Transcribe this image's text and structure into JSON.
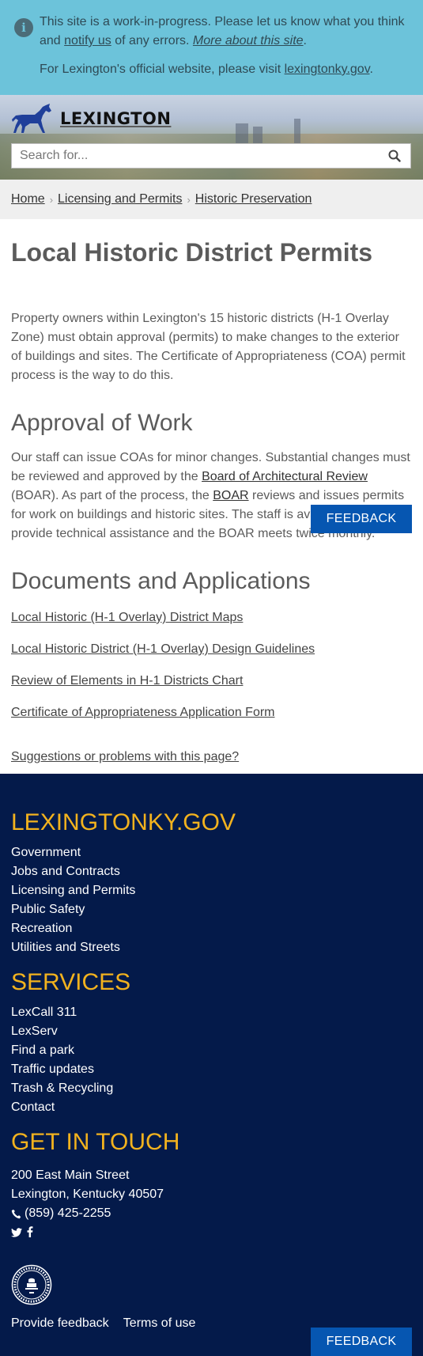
{
  "banner": {
    "icon": "info-icon",
    "msg_prefix": "This site is a work-in-progress. Please let us know what you think and",
    "notify_link": "notify us",
    "msg_middle": "of any errors.",
    "more_link": "More about this site",
    "msg_end": ".",
    "official_prefix": "For Lexington's official website, please visit",
    "official_link": "lexingtonky.gov",
    "official_end": "."
  },
  "header": {
    "logo_icon": "horse-icon",
    "brand": "LEXINGTON",
    "search_placeholder": "Search for...",
    "search_icon": "search-icon"
  },
  "breadcrumb": {
    "items": [
      "Home",
      "Licensing and Permits",
      "Historic Preservation"
    ]
  },
  "main": {
    "title": "Local Historic District Permits",
    "intro": "Property owners within Lexington's 15 historic districts (H-1 Overlay Zone) must obtain approval (permits) to make changes to the exterior of buildings and sites. The Certificate of Appropriateness (COA) permit process is the way to do this.",
    "approval_heading": "Approval of Work",
    "approval_part1": "Our staff can issue COAs for minor changes. Substantial changes must be reviewed and approved by the",
    "boar_link": "Board of Architectural Review",
    "approval_part2": "(BOAR). As part of the process, the",
    "boar_short_link": "BOAR",
    "approval_part3": "reviews and issues permits for work on buildings and historic sites. The staff is available daily to provide technical assistance and the BOAR meets twice monthly.",
    "docs_heading": "Documents and Applications",
    "docs": [
      "Local Historic (H-1 Overlay) District Maps",
      "Local Historic District (H-1 Overlay) Design Guidelines",
      "Review of Elements in H-1 Districts Chart",
      "Certificate of Appropriateness Application Form"
    ],
    "suggestions": "Suggestions or problems with this page?"
  },
  "feedback_label": "FEEDBACK",
  "footer": {
    "gov_heading": "LEXINGTONKY.GOV",
    "gov_links": [
      "Government",
      "Jobs and Contracts",
      "Licensing and Permits",
      "Public Safety",
      "Recreation",
      "Utilities and Streets"
    ],
    "services_heading": "SERVICES",
    "services_links": [
      "LexCall 311",
      "LexServ",
      "Find a park",
      "Traffic updates",
      "Trash & Recycling",
      "Contact"
    ],
    "touch_heading": "GET IN TOUCH",
    "address_line1": "200 East Main Street",
    "address_line2": "Lexington, Kentucky 40507",
    "phone": "(859) 425-2255",
    "phone_icon": "phone-icon",
    "social_icons": [
      "twitter-icon",
      "facebook-icon"
    ],
    "seal_icon": "city-seal-icon",
    "provide_feedback": "Provide feedback",
    "terms": "Terms of use"
  },
  "colors": {
    "banner_bg": "#6cc3da",
    "footer_bg": "#041a4a",
    "footer_heading": "#f2b21e",
    "feedback_button": "#0656b1",
    "horse": "#1f3f9a"
  }
}
